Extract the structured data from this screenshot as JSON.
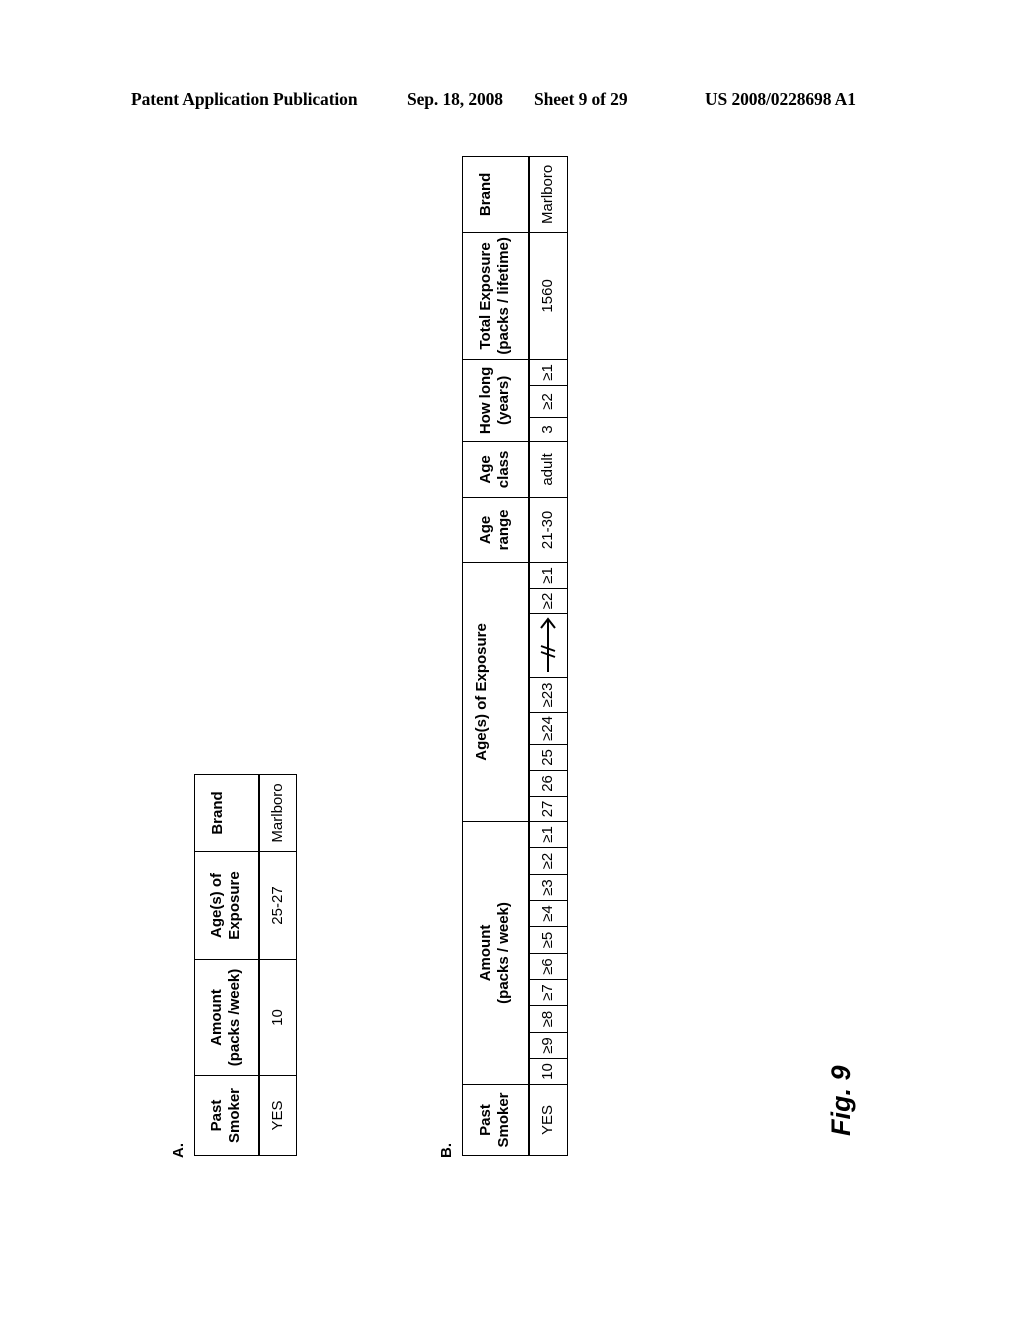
{
  "header": {
    "publication": "Patent Application Publication",
    "date": "Sep. 18, 2008",
    "sheet": "Sheet 9 of 29",
    "number": "US 2008/0228698 A1"
  },
  "table_a": {
    "label": "A.",
    "headers": [
      [
        "Past",
        "Smoker"
      ],
      [
        "Amount",
        "(packs /week)"
      ],
      [
        "Age(s) of",
        "Exposure"
      ],
      [
        "Brand",
        ""
      ]
    ],
    "row": [
      "YES",
      "10",
      "25-27",
      "Marlboro"
    ]
  },
  "table_b": {
    "label": "B.",
    "headers": {
      "past_smoker": [
        "Past",
        "Smoker"
      ],
      "amount": [
        "Amount",
        "(packs / week)"
      ],
      "ages": "Age(s) of Exposure",
      "age_range": [
        "Age",
        "range"
      ],
      "age_class": [
        "Age",
        "class"
      ],
      "how_long": [
        "How long",
        "(years)"
      ],
      "total_exposure": [
        "Total Exposure",
        "(packs / lifetime)"
      ],
      "brand": "Brand"
    },
    "row": {
      "past_smoker": "YES",
      "amount": [
        "10",
        "≥9",
        "≥8",
        "≥7",
        "≥6",
        "≥5",
        "≥4",
        "≥3",
        "≥2",
        "≥1"
      ],
      "ages": [
        "27",
        "26",
        "25",
        "≥24",
        "≥23",
        "arrow-break",
        "≥2",
        "≥1"
      ],
      "age_range": "21-30",
      "age_class": "adult",
      "how_long": [
        "3",
        "≥2",
        "≥1"
      ],
      "total_exposure": "1560",
      "brand": "Marlboro"
    }
  },
  "figure_label": "Fig. 9"
}
